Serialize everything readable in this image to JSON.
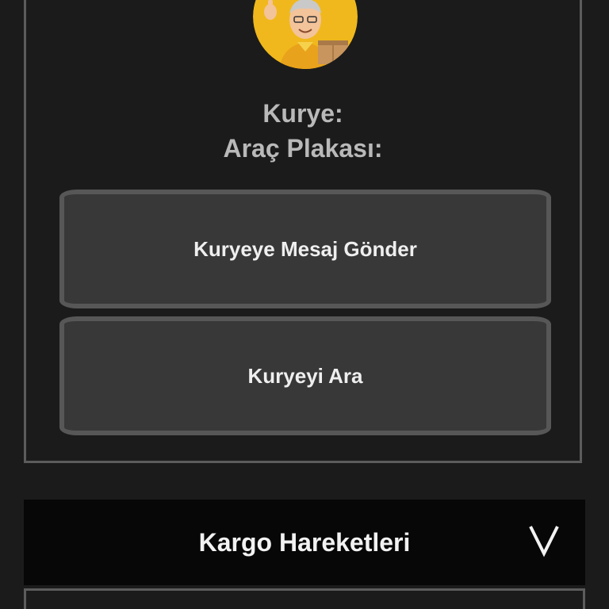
{
  "courier_card": {
    "courier_label": "Kurye:",
    "plate_label": "Araç Plakası:",
    "message_button": "Kuryeye Mesaj Gönder",
    "call_button": "Kuryeyi Ara"
  },
  "tracking": {
    "title": "Kargo Hareketleri",
    "toggle_icon": "chevron-down-icon"
  },
  "colors": {
    "background": "#1b1b1b",
    "button": "#383838",
    "button_border": "#575757",
    "header": "#070707",
    "avatar_yellow": "#f0b81c"
  }
}
